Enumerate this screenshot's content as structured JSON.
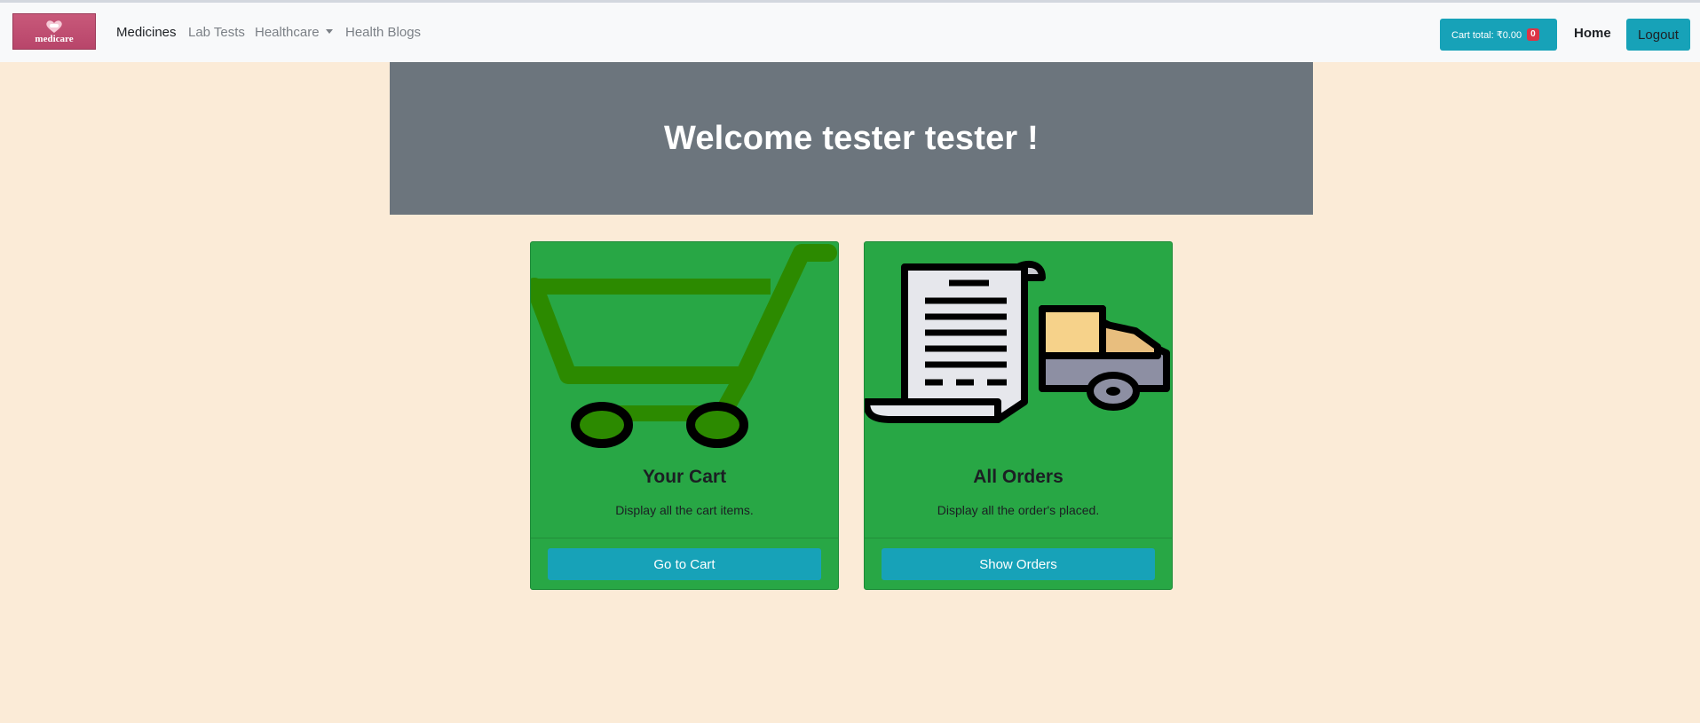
{
  "brand": {
    "logo_text": "medicare"
  },
  "nav": {
    "links": [
      "Medicines",
      "Lab Tests",
      "Healthcare",
      "Health Blogs"
    ],
    "cart": {
      "label": "Cart total: ₹0.00",
      "count": "0"
    },
    "home": "Home",
    "logout": "Logout"
  },
  "hero": {
    "title": "Welcome tester tester !"
  },
  "cards": [
    {
      "title": "Your Cart",
      "text": "Display all the cart items.",
      "button": "Go to Cart",
      "image_icon": "cart-icon"
    },
    {
      "title": "All Orders",
      "text": "Display all the order's placed.",
      "button": "Show Orders",
      "image_icon": "orders-delivery-icon"
    }
  ],
  "colors": {
    "page_bg": "#fbebd7",
    "navbar_bg": "#f8f9fa",
    "hero_bg": "#6c757d",
    "card_bg": "#28a745",
    "button_info": "#17a2b8",
    "badge_danger": "#dc3545"
  }
}
